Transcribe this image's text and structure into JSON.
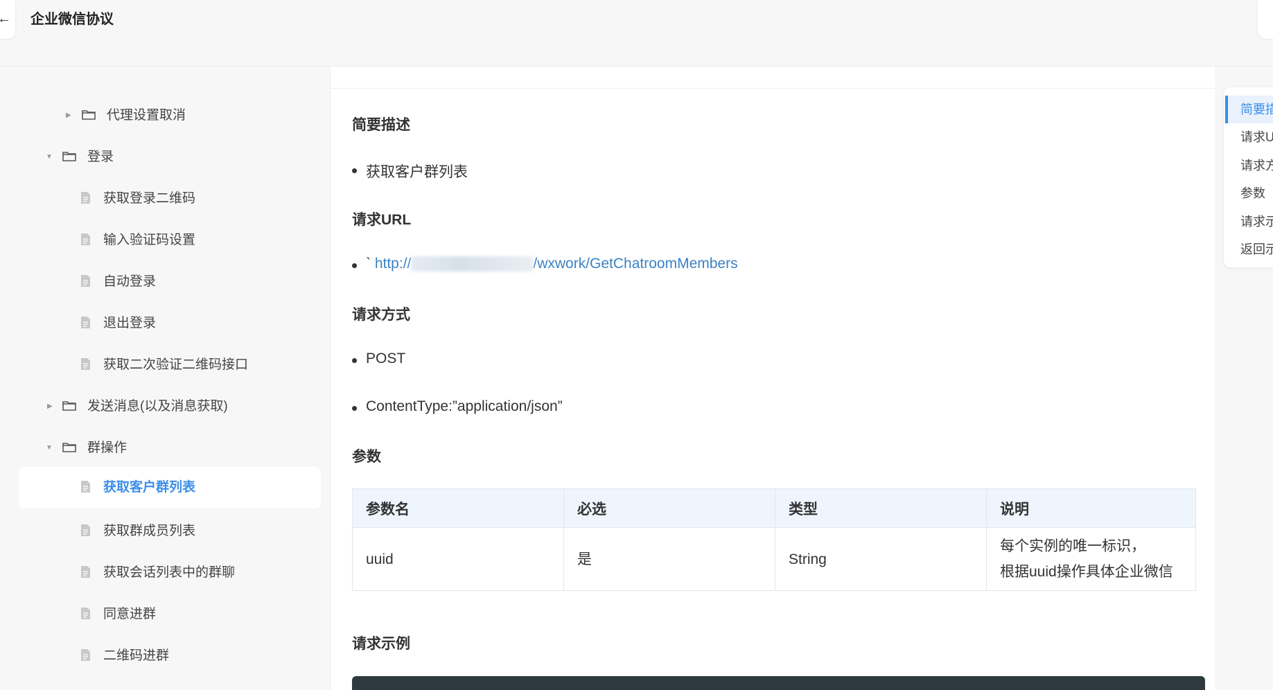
{
  "header": {
    "back_glyph": "←",
    "title": "企业微信协议"
  },
  "sidebar": {
    "items": [
      {
        "label": "代理设置取消",
        "kind": "folder",
        "state": "collapsed"
      },
      {
        "label": "登录",
        "kind": "folder",
        "state": "expanded"
      },
      {
        "label": "获取登录二维码",
        "kind": "doc"
      },
      {
        "label": "输入验证码设置",
        "kind": "doc"
      },
      {
        "label": "自动登录",
        "kind": "doc"
      },
      {
        "label": "退出登录",
        "kind": "doc"
      },
      {
        "label": "获取二次验证二维码接口",
        "kind": "doc"
      },
      {
        "label": "发送消息(以及消息获取)",
        "kind": "folder",
        "state": "collapsed"
      },
      {
        "label": "群操作",
        "kind": "folder",
        "state": "expanded"
      },
      {
        "label": "获取客户群列表",
        "kind": "doc",
        "active": true
      },
      {
        "label": "获取群成员列表",
        "kind": "doc"
      },
      {
        "label": "获取会话列表中的群聊",
        "kind": "doc"
      },
      {
        "label": "同意进群",
        "kind": "doc"
      },
      {
        "label": "二维码进群",
        "kind": "doc"
      }
    ]
  },
  "doc": {
    "section_summary": "简要描述",
    "summary_item": "获取客户群列表",
    "section_url": "请求URL",
    "url_prefix": "` ",
    "url_scheme": "http://",
    "url_path": "/wxwork/GetChatroomMembers",
    "section_method": "请求方式",
    "method_item": "POST",
    "content_type_item": "ContentType:”application/json”",
    "section_params": "参数",
    "params_table": {
      "headers": [
        "参数名",
        "必选",
        "类型",
        "说明"
      ],
      "rows": [
        {
          "name": "uuid",
          "required": "是",
          "type": "String",
          "desc_line1": "每个实例的唯一标识，",
          "desc_line2": "根据uuid操作具体企业微信"
        }
      ]
    },
    "section_example": "请求示例"
  },
  "toc": {
    "items": [
      {
        "label": "简要描",
        "active": true
      },
      {
        "label": "请求U"
      },
      {
        "label": "请求方"
      },
      {
        "label": "参数"
      },
      {
        "label": "请求示"
      },
      {
        "label": "返回示"
      }
    ]
  },
  "colors": {
    "accent": "#3b8eea",
    "link": "#3b82c4",
    "table_header_bg": "#eef5fd",
    "code_bg": "#2e3a3f"
  }
}
